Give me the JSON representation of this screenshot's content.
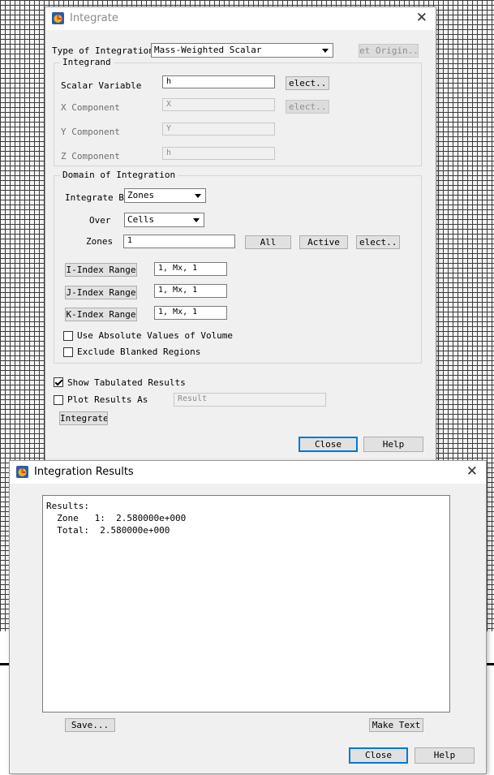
{
  "integrate_dialog": {
    "title": "Integrate",
    "type_label": "Type of Integration",
    "type_value": "Mass-Weighted Scalar",
    "set_origin_button": "et Origin..",
    "integrand": {
      "legend": "Integrand",
      "scalar_label": "Scalar Variable",
      "scalar_value": "h",
      "scalar_select": "elect...",
      "x_label": "X Component",
      "x_value": "X",
      "x_select": "elect...",
      "y_label": "Y Component",
      "y_value": "Y",
      "z_label": "Z Component",
      "z_value": "h"
    },
    "domain": {
      "legend": "Domain of Integration",
      "integrate_by_label": "Integrate By",
      "integrate_by_value": "Zones",
      "over_label": "Over",
      "over_value": "Cells",
      "zones_label": "Zones",
      "zones_value": "1",
      "all_button": "All",
      "active_button": "Active",
      "select_button": "elect...",
      "i_range_button": "I-Index Range",
      "i_range_value": "1, Mx, 1",
      "j_range_button": "J-Index Range",
      "j_range_value": "1, Mx, 1",
      "k_range_button": "K-Index Range",
      "k_range_value": "1, Mx, 1",
      "abs_volume_label": "Use Absolute Values of Volume",
      "abs_volume_checked": false,
      "exclude_blanked_label": "Exclude Blanked Regions",
      "exclude_blanked_checked": false
    },
    "show_tabulated_label": "Show Tabulated Results",
    "show_tabulated_checked": true,
    "plot_results_label": "Plot Results As",
    "plot_results_checked": false,
    "plot_results_value": "Result",
    "integrate_button": "Integrate",
    "close_button": "Close",
    "help_button": "Help"
  },
  "results_dialog": {
    "title": "Integration Results",
    "results_text": "Results:\n  Zone   1:  2.580000e+000\n  Total:  2.580000e+000",
    "save_button": "Save...",
    "make_text_button": "Make Text",
    "close_button": "Close",
    "help_button": "Help"
  }
}
